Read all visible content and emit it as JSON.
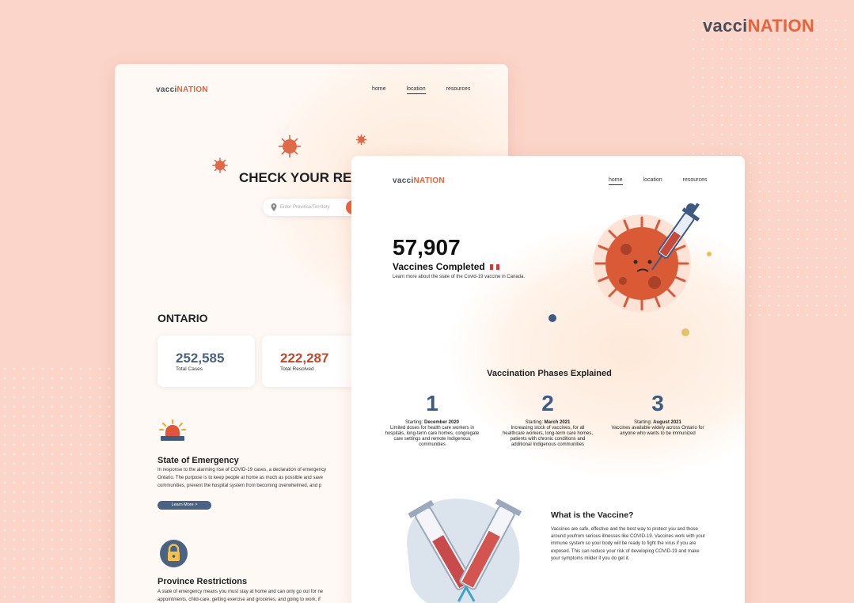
{
  "brand": {
    "prefix": "vacci",
    "suffix": "NATION"
  },
  "colors": {
    "background": "#fbd5c9",
    "accent": "#e8633a",
    "navy": "#3c5a82",
    "brand_gray": "#4a4f57"
  },
  "back_page": {
    "nav": [
      "home",
      "location",
      "resources"
    ],
    "active_nav": "location",
    "title": "CHECK YOUR REG",
    "search_placeholder": "Enter Province/Territory",
    "province": "ONTARIO",
    "stats": [
      {
        "value": "252,585",
        "label": "Total Cases",
        "color": "#4a6283"
      },
      {
        "value": "222,287",
        "label": "Total Resolved",
        "color": "#c4472a"
      }
    ],
    "emergency": {
      "title": "State of Emergency",
      "lines": [
        "In response to the alarming rise of COVID-19 cases, a declaration of emergency",
        "Ontario. The purpose is to keep people at home as much as possible and save",
        "communities, prevent the hospital system from becoming overwhelmed, and p"
      ],
      "button": "Learn More >"
    },
    "restrictions": {
      "title": "Province Restrictions",
      "lines": [
        "A state of emergency means you must stay at home and can only go out for ne",
        "appointments, child-care, getting exercise and groceries, and going to work, if"
      ]
    }
  },
  "front_page": {
    "nav": [
      "home",
      "location",
      "resources"
    ],
    "active_nav": "home",
    "vaccines_count": "57,907",
    "vaccines_label": "Vaccines Completed",
    "vaccines_sub": "Learn more about the state of the Covid-19 vaccine in Canada.",
    "phases_title": "Vaccination Phases Explained",
    "phases": [
      {
        "number": "1",
        "start_prefix": "Starting: ",
        "start": "December 2020",
        "desc": "Limited doses for health care workers in hospitals, long-term care homes, congregate care settings and remote Indigenous communities"
      },
      {
        "number": "2",
        "start_prefix": "Starting: ",
        "start": "March 2021",
        "desc": "Increasing stock of vaccines, for all healthcare workers, long-term care homes, patients with chronic conditions and additional Indigenous communities"
      },
      {
        "number": "3",
        "start_prefix": "Starting: ",
        "start": "August 2021",
        "desc": "Vaccines available widely across Ontario for anyone who wants to be immunized"
      }
    ],
    "what_title": "What is the Vaccine?",
    "what_body": "Vaccines are safe, effective and the best way to protect you and those around youfrom serious illnesses like COVID-19. Vaccines work with your immune system so your body will be ready to fight the virus if you are exposed. This can reduce your risk of developing COVID-19 and make your symptoms milder if you do get it."
  }
}
